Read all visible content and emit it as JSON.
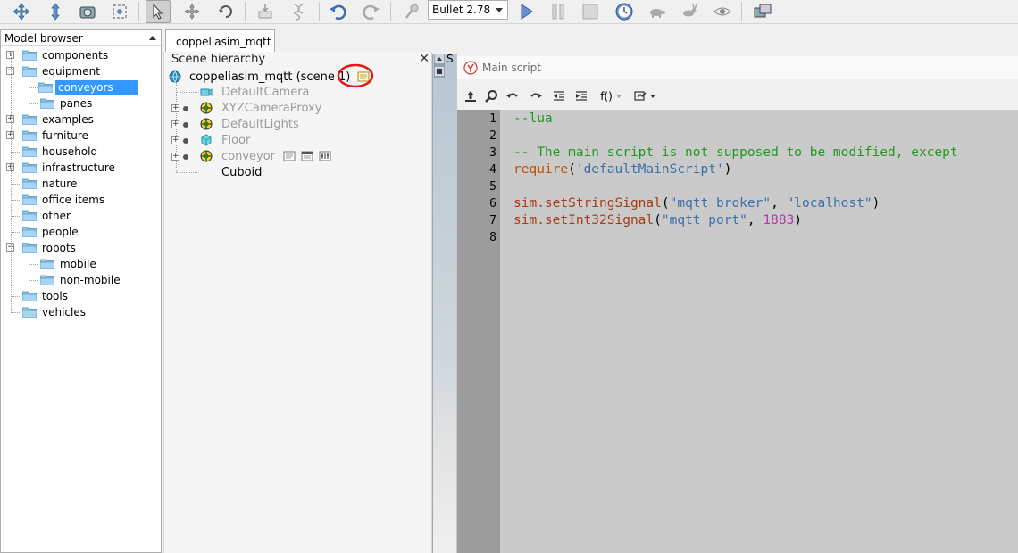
{
  "toolbar": {
    "engine_select": "Bullet 2.78"
  },
  "model_browser": {
    "title": "Model browser",
    "items": [
      {
        "label": "components",
        "level": 0,
        "expander": "+"
      },
      {
        "label": "equipment",
        "level": 0,
        "expander": "-"
      },
      {
        "label": "conveyors",
        "level": 1,
        "expander": "",
        "selected": true
      },
      {
        "label": "panes",
        "level": 1,
        "expander": ""
      },
      {
        "label": "examples",
        "level": 0,
        "expander": "+"
      },
      {
        "label": "furniture",
        "level": 0,
        "expander": "+"
      },
      {
        "label": "household",
        "level": 0,
        "expander": ""
      },
      {
        "label": "infrastructure",
        "level": 0,
        "expander": "+"
      },
      {
        "label": "nature",
        "level": 0,
        "expander": ""
      },
      {
        "label": "office items",
        "level": 0,
        "expander": ""
      },
      {
        "label": "other",
        "level": 0,
        "expander": ""
      },
      {
        "label": "people",
        "level": 0,
        "expander": ""
      },
      {
        "label": "robots",
        "level": 0,
        "expander": "-"
      },
      {
        "label": "mobile",
        "level": 1,
        "expander": ""
      },
      {
        "label": "non-mobile",
        "level": 1,
        "expander": ""
      },
      {
        "label": "tools",
        "level": 0,
        "expander": ""
      },
      {
        "label": "vehicles",
        "level": 0,
        "expander": ""
      }
    ]
  },
  "scene_tab": {
    "label": "coppeliasim_mqtt"
  },
  "scene_hierarchy": {
    "title": "Scene hierarchy",
    "root": "coppeliasim_mqtt (scene 1)",
    "items": [
      {
        "label": "DefaultCamera",
        "icon": "camera-icon"
      },
      {
        "label": "XYZCameraProxy",
        "icon": "dummy-icon"
      },
      {
        "label": "DefaultLights",
        "icon": "light-icon"
      },
      {
        "label": "Floor",
        "icon": "shape-icon"
      },
      {
        "label": "conveyor",
        "icon": "dummy-icon"
      },
      {
        "label": "Cuboid",
        "icon": "shape-icon"
      }
    ]
  },
  "main_script": {
    "title": "Main script",
    "line_numbers": [
      "1",
      "2",
      "3",
      "4",
      "5",
      "6",
      "7",
      "8"
    ],
    "lines": {
      "l1": "--lua",
      "l3": "-- The main script is not supposed to be modified, except",
      "l4_func": "require",
      "l4_arg": "'defaultMainScript'",
      "l6_func": "sim.setStringSignal",
      "l6_a1": "\"mqtt_broker\"",
      "l6_a2": "\"localhost\"",
      "l7_func": "sim.setInt32Signal",
      "l7_a1": "\"mqtt_port\"",
      "l7_a2": "1883"
    },
    "func_label": "f()"
  }
}
